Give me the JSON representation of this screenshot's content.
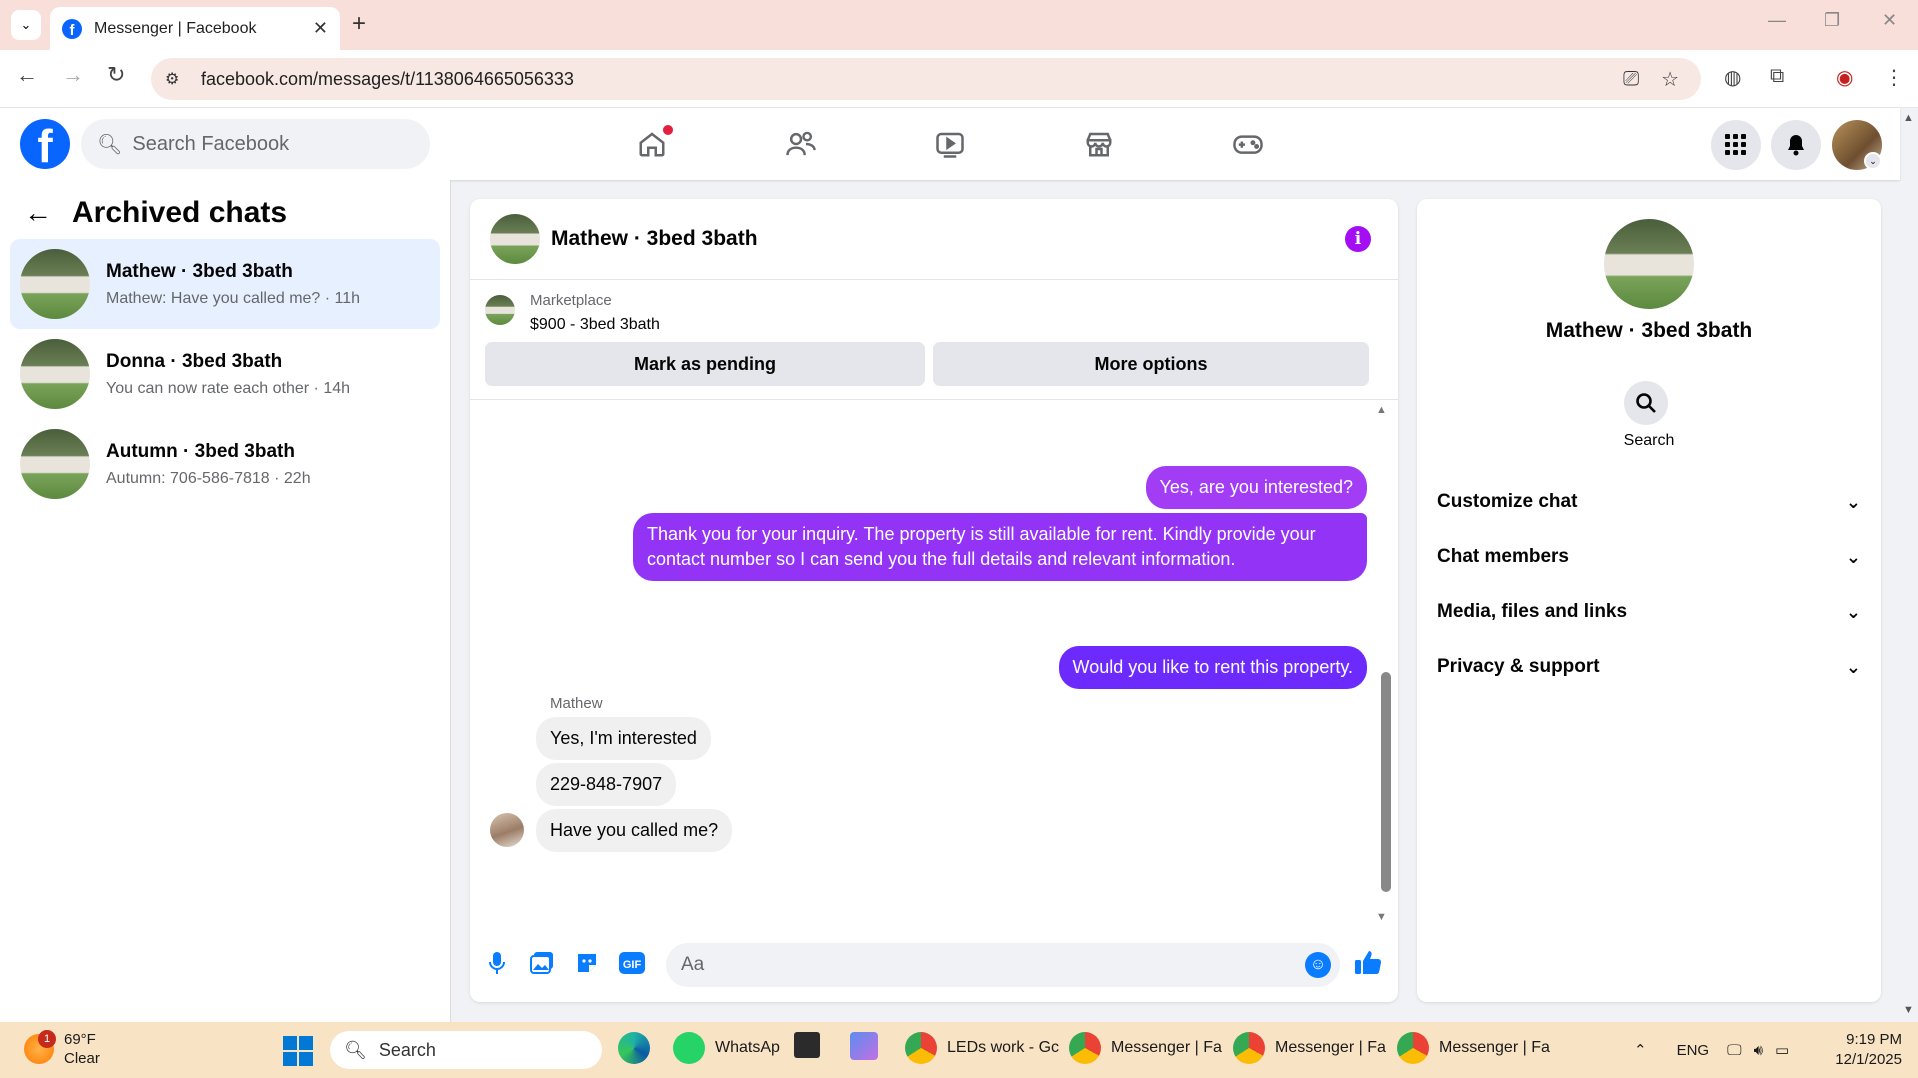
{
  "browser": {
    "tab_title": "Messenger | Facebook",
    "url": "facebook.com/messages/t/1138064665056333"
  },
  "facebook": {
    "search_placeholder": "Search Facebook"
  },
  "sidebar": {
    "title": "Archived chats",
    "chats": [
      {
        "name": "Mathew · 3bed 3bath",
        "preview": "Mathew: Have you called me? · 11h",
        "active": true
      },
      {
        "name": "Donna · 3bed 3bath",
        "preview": "You can now rate each other · 14h",
        "active": false
      },
      {
        "name": "Autumn · 3bed 3bath",
        "preview": "Autumn: 706-586-7818 · 22h",
        "active": false
      }
    ]
  },
  "conversation": {
    "title": "Mathew · 3bed 3bath",
    "marketplace": {
      "label": "Marketplace",
      "listing": "$900 - 3bed 3bath",
      "mark_pending": "Mark as pending",
      "more_options": "More options"
    },
    "messages_out": [
      "Yes, are you interested?",
      "Thank you for your inquiry. The property is still available for rent. Kindly provide your contact number so I can send you the full details and relevant information.",
      "Would you like to rent this property."
    ],
    "sender_name": "Mathew",
    "messages_in": [
      "Yes, I'm interested",
      "229-848-7907",
      "Have you called me?"
    ],
    "composer_placeholder": "Aa"
  },
  "right_panel": {
    "name": "Mathew · 3bed 3bath",
    "search_label": "Search",
    "sections": [
      "Customize chat",
      "Chat members",
      "Media, files and links",
      "Privacy & support"
    ]
  },
  "taskbar": {
    "weather_temp": "69°F",
    "weather_desc": "Clear",
    "weather_badge": "1",
    "search_label": "Search",
    "apps": [
      {
        "label": "WhatsAp",
        "icon": "whatsapp-icon"
      },
      {
        "label": "LEDs work - Gc",
        "icon": "chrome-icon"
      },
      {
        "label": "Messenger | Fa",
        "icon": "chrome-icon"
      },
      {
        "label": "Messenger | Fa",
        "icon": "chrome-icon"
      },
      {
        "label": "Messenger | Fa",
        "icon": "chrome-icon"
      }
    ],
    "language": "ENG",
    "time": "9:19 PM",
    "date": "12/1/2025"
  },
  "colors": {
    "fb_blue": "#0866ff",
    "bubble_purple": "#a33cf5",
    "bubble_violet": "#6c2bfc",
    "info_purple": "#a30ef2",
    "active_chat_bg": "#e7f0fe"
  }
}
